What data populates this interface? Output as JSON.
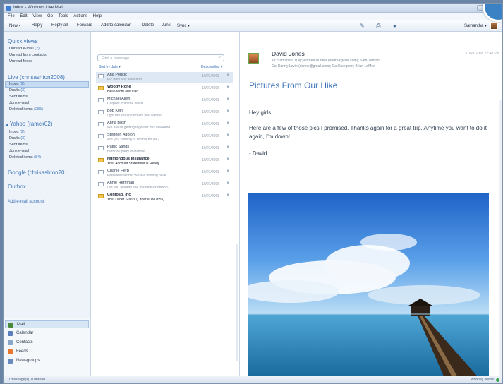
{
  "window": {
    "title": "Inbox - Windows Live Mail"
  },
  "menu": [
    "File",
    "Edit",
    "View",
    "Go",
    "Tools",
    "Actions",
    "Help"
  ],
  "toolbar": {
    "new": "New ▾",
    "reply": "Reply",
    "reply_all": "Reply all",
    "forward": "Forward",
    "add_calendar": "Add to calendar",
    "delete": "Delete",
    "junk": "Junk",
    "sync": "Sync ▾",
    "account": "Samantha ▾"
  },
  "folders": {
    "quick_views": {
      "title": "Quick views",
      "items": [
        {
          "label": "Unread e-mail",
          "count": "(2)"
        },
        {
          "label": "Unread from contacts",
          "count": ""
        },
        {
          "label": "Unread feeds",
          "count": ""
        }
      ]
    },
    "live": {
      "title": "Live (chrisashton2008)",
      "items": [
        {
          "label": "Inbox",
          "count": "(2)"
        },
        {
          "label": "Drafts",
          "count": "(3)"
        },
        {
          "label": "Sent items",
          "count": ""
        },
        {
          "label": "Junk e-mail",
          "count": ""
        },
        {
          "label": "Deleted items",
          "count": "(285)"
        }
      ]
    },
    "yahoo": {
      "title": "Yahoo (ramck02)",
      "items": [
        {
          "label": "Inbox",
          "count": "(2)"
        },
        {
          "label": "Drafts",
          "count": "(3)"
        },
        {
          "label": "Sent items",
          "count": ""
        },
        {
          "label": "Junk e-mail",
          "count": ""
        },
        {
          "label": "Deleted items",
          "count": "(84)"
        }
      ]
    },
    "google": {
      "title": "Google (chrisashton20..."
    },
    "outbox": {
      "title": "Outbox"
    },
    "add_account": "Add e-mail account"
  },
  "nav": [
    {
      "label": "Mail",
      "color": "#4a8a3a"
    },
    {
      "label": "Calendar",
      "color": "#5b7fb8"
    },
    {
      "label": "Contacts",
      "color": "#8aa6c8"
    },
    {
      "label": "Feeds",
      "color": "#e8772e"
    },
    {
      "label": "Newsgroups",
      "color": "#6a8ac0"
    }
  ],
  "message_list": {
    "search_placeholder": "Find a message",
    "sort_left": "Sort by date ▾",
    "sort_right": "Descending ▾",
    "messages": [
      {
        "from": "Ana Pericic",
        "subject": "Pic from last weekend",
        "date": "10/21/2008",
        "unread": false,
        "selected": true
      },
      {
        "from": "Woody Rohe",
        "subject": "Hello Mom and Dad",
        "date": "10/21/2008",
        "unread": true,
        "selected": false
      },
      {
        "from": "Michael Allen",
        "subject": "Carpool from the office",
        "date": "10/21/2008",
        "unread": false,
        "selected": false
      },
      {
        "from": "Bob Kelly",
        "subject": "I got the season tickets you wanted",
        "date": "10/21/2008",
        "unread": false,
        "selected": false
      },
      {
        "from": "Anna Bosh",
        "subject": "We are all getting together this weekend...",
        "date": "10/21/2008",
        "unread": false,
        "selected": false
      },
      {
        "from": "Stephen Adolphi",
        "subject": "Are you coming to Mom's house?",
        "date": "10/21/2008",
        "unread": false,
        "selected": false
      },
      {
        "from": "Patric Sands",
        "subject": "Birthday party invitations",
        "date": "10/21/2008",
        "unread": false,
        "selected": false
      },
      {
        "from": "Humongous Insurance",
        "subject": "Your Account Statement is Ready",
        "date": "10/21/2008",
        "unread": true,
        "selected": false
      },
      {
        "from": "Charlie Herb",
        "subject": "Farewell friends! We are moving back",
        "date": "10/21/2008",
        "unread": false,
        "selected": false
      },
      {
        "from": "Annie Herriman",
        "subject": "Did you already see the new exhibition?",
        "date": "10/21/2008",
        "unread": false,
        "selected": false
      },
      {
        "from": "Contoso, Inc",
        "subject": "Your Order Status (Order #0887655)",
        "date": "10/21/2008",
        "unread": true,
        "selected": false
      }
    ]
  },
  "reading": {
    "sender": "David Jones",
    "to": "To: Samantha Tully; Andrea Dunker (andrea@live.com); Sam Tillman",
    "cc": "Cc: Danny Levin (danny@gmail.com); Carl Longdon; Brian LaMee",
    "date": "10/21/2008 12:48 PM",
    "subject": "Pictures From Our Hike",
    "greeting": "Hey girls,",
    "body": "Here are a few of those pics I promised. Thanks again for a great trip. Anytime you want to do it again, I'm down!",
    "signature": "- David"
  },
  "status": {
    "left": "0 message(s), 0 unread",
    "right": "Working online"
  }
}
